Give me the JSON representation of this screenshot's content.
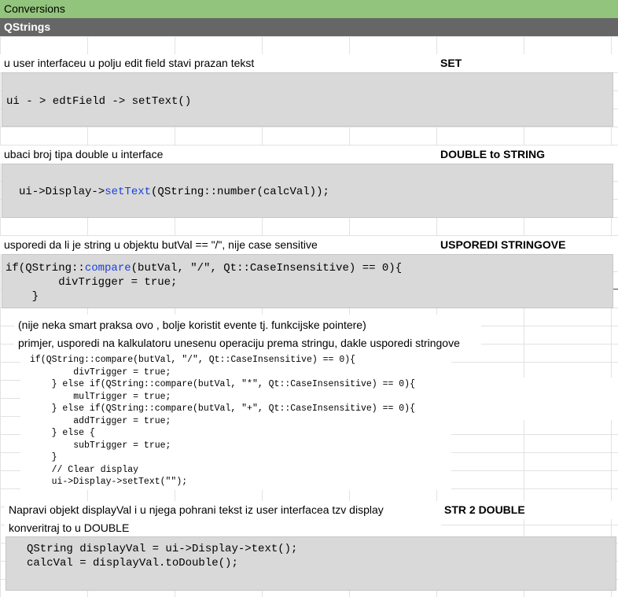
{
  "header": {
    "title": "Conversions",
    "subtitle": "QStrings"
  },
  "sections": [
    {
      "description": "u user interfaceu u polju edit field stavi prazan tekst",
      "label": "SET",
      "code": "ui - > edtField -> setText()"
    },
    {
      "description": "ubaci broj tipa double u interface",
      "label": "DOUBLE to STRING",
      "code_pre": "ui->Display->",
      "code_kw": "setText",
      "code_post": "(QString::number(calcVal));"
    },
    {
      "description": "usporedi da li je string u objektu butVal == \"/\", nije case sensitive",
      "label": "USPOREDI STRINGOVE",
      "code_l1_pre": "if(QString::",
      "code_l1_kw": "compare",
      "code_l1_post": "(butVal, \"/\", Qt::CaseInsensitive) == 0){",
      "code_l2": "        divTrigger = true;",
      "code_l3": "    }"
    }
  ],
  "note": {
    "line1": "(nije neka smart praksa ovo , bolje koristit evente tj. funkcijske pointere)",
    "line2": "primjer, usporedi na kalkulatoru unesenu operaciju prema stringu, dakle usporedi stringove",
    "code": "if(QString::compare(butVal, \"/\", Qt::CaseInsensitive) == 0){\n        divTrigger = true;\n    } else if(QString::compare(butVal, \"*\", Qt::CaseInsensitive) == 0){\n        mulTrigger = true;\n    } else if(QString::compare(butVal, \"+\", Qt::CaseInsensitive) == 0){\n        addTrigger = true;\n    } else {\n        subTrigger = true;\n    }\n    // Clear display\n    ui->Display->setText(\"\");"
  },
  "str2double": {
    "description1": "Napravi objekt displayVal i u njega pohrani tekst iz user interfacea tzv display",
    "description2": "konveritraj to u DOUBLE",
    "label": "STR 2 DOUBLE",
    "code": "QString displayVal = ui->Display->text();\ncalcVal = displayVal.toDouble();"
  },
  "colors": {
    "header_green": "#93c47d",
    "header_gray": "#666666",
    "code_bg": "#d9d9d9",
    "keyword_blue": "#1a3fd6"
  }
}
